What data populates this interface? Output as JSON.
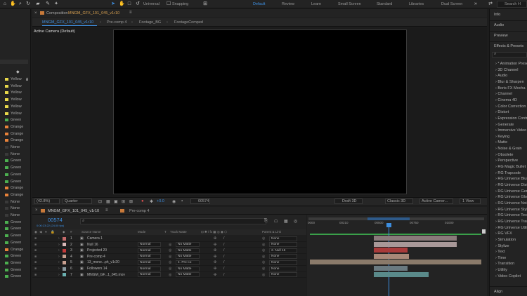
{
  "workspaces": {
    "default": "Default",
    "review": "Review",
    "learn": "Learn",
    "small_screen": "Small Screen",
    "standard": "Standard",
    "libraries": "Libraries",
    "dual_screen": "Dual Screen",
    "universal": "Universal",
    "snapping": "Snapping"
  },
  "search_top": "Search H",
  "composition": {
    "header_label": "Composition",
    "header_name": "MNGM_GFX_101_045_v1r10",
    "tabs": [
      "MNGM_GFX_101_045_v1r10",
      "Pre-comp 4",
      "Footage_BG",
      "FootageComped"
    ],
    "camera_label": "Active Camera (Default)"
  },
  "viewer_bar": {
    "zoom": "(42.8%)",
    "resolution": "Quarter",
    "exposure": "+0.0",
    "timecode": "00574",
    "renderer": "Draft 3D",
    "renderer_mode": "Classic 3D",
    "camera": "Active Camer...",
    "views": "1 View"
  },
  "left_labels": [
    "Yellow",
    "Yellow",
    "Yellow",
    "Yellow",
    "Yellow",
    "Yellow",
    "Green",
    "Orange",
    "Orange",
    "Orange",
    "None",
    "None",
    "Green",
    "Green",
    "Green",
    "Green",
    "Orange",
    "Orange",
    "None",
    "None",
    "None",
    "Green",
    "Green",
    "Green",
    "Green",
    "Orange",
    "Green",
    "Green",
    "Green",
    "Green"
  ],
  "label_colors": {
    "Yellow": "#e8d84a",
    "Green": "#4caf50",
    "Orange": "#e8823a",
    "None": "#3a3a3a"
  },
  "timeline": {
    "tabs": [
      "MNGM_GFX_101_045_v1r10",
      "Pre-comp 4"
    ],
    "current_time": "00574",
    "time_sub": "0:00:23:22 (24.00 fps)",
    "columns": {
      "source_name": "Source Name",
      "mode": "Mode",
      "t": "T",
      "track_matte": "Track Matte",
      "parent": "Parent & Link"
    },
    "ruler": [
      "0000",
      "00210",
      "00500",
      "00750",
      "01000"
    ],
    "layers": [
      {
        "num": "1",
        "name": "Camera 1",
        "mode": "",
        "matte": "",
        "parent": "None",
        "color": "#c46a6a"
      },
      {
        "num": "2",
        "name": "Null 16",
        "mode": "Normal",
        "matte": "No Matte",
        "parent": "None",
        "color": "#d8b8b8"
      },
      {
        "num": "3",
        "name": "Projected 20",
        "mode": "Normal",
        "matte": "No Matte",
        "parent": "2. Null 16",
        "color": "#c43a3a"
      },
      {
        "num": "4",
        "name": "Pre-comp 4",
        "mode": "Normal",
        "matte": "No Matte",
        "parent": "None",
        "color": "#c8a090"
      },
      {
        "num": "5",
        "name": "13_mone...ph_v1r20",
        "mode": "Normal",
        "matte": "4. Pre-co",
        "parent": "None",
        "color": "#c8a090"
      },
      {
        "num": "6",
        "name": "Followers 14",
        "mode": "Normal",
        "matte": "No Matte",
        "parent": "None",
        "color": "#8a9aa0"
      },
      {
        "num": "7",
        "name": "MNGM_GF...1_045.mov",
        "mode": "Normal",
        "matte": "No Matte",
        "parent": "None",
        "color": "#6ab0b0"
      }
    ]
  },
  "right_panel": {
    "tabs": [
      "Info",
      "Audio",
      "Preview",
      "Effects & Presets"
    ],
    "effects": [
      "* Animation Prese",
      "3D Channel",
      "Audio",
      "Blur & Sharpen",
      "Boris FX Mocha",
      "Channel",
      "Cinema 4D",
      "Color Correction",
      "Distort",
      "Expression Contro",
      "Generate",
      "Immersive Video",
      "Keying",
      "Matte",
      "Noise & Grain",
      "Obsolete",
      "Perspective",
      "RG Magic Bullet",
      "RG Trapcode",
      "RG Universe Blur",
      "RG Universe Disto",
      "RG Universe Gene",
      "RG Universe Glow",
      "RG Universe Noise",
      "RG Universe Stylize",
      "RG Universe Text",
      "RG Universe Transi",
      "RG Universe Utilit",
      "RG VFX",
      "Simulation",
      "Stylize",
      "Text",
      "Time",
      "Transition",
      "Utility",
      "Video Copilot"
    ],
    "align": "Align"
  }
}
